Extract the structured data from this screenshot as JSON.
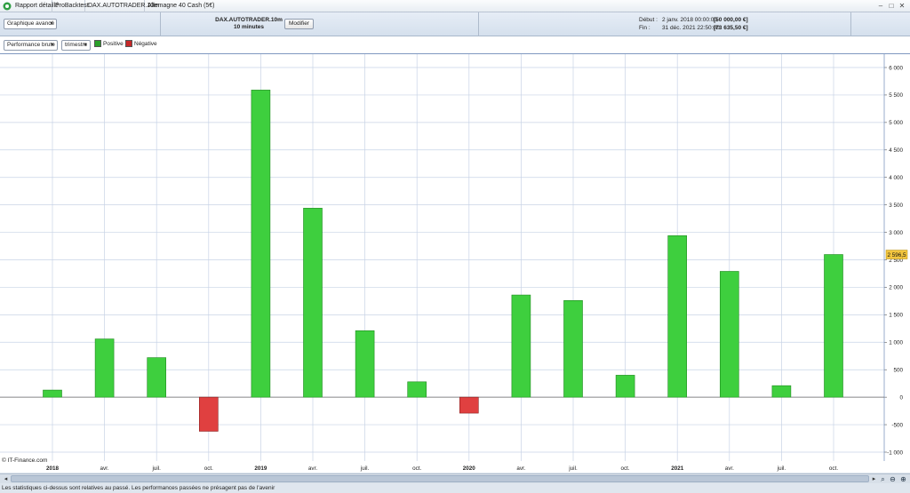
{
  "titlebar": {
    "tabs": [
      "Rapport détaillé",
      "ProBacktest",
      "DAX.AUTOTRADER.10m",
      "Allemagne 40 Cash (5€)"
    ],
    "buttons": [
      "–",
      "□",
      "✕"
    ]
  },
  "header": {
    "graph_mode": "Graphique avancé",
    "strategy_name": "DAX.AUTOTRADER.10m",
    "timeframe": "10 minutes",
    "modify_label": "Modifier",
    "start_label": "Début :",
    "start_date": "2 janv. 2018 00:00:00",
    "start_capital": "[50 000,00 €]",
    "end_label": "Fin :",
    "end_date": "31 déc. 2021 22:50:00",
    "end_capital": "[73 635,50 €]"
  },
  "toolbar": {
    "performance_type": "Performance brute",
    "period": "trimestre",
    "legend_positive": "Positive",
    "legend_negative": "Négative"
  },
  "colors": {
    "positive": "#3ecf3e",
    "positive_stroke": "#1f8a1f",
    "negative": "#e04040",
    "negative_stroke": "#8a1f1f",
    "grid": "#c8d3e6",
    "last_value_bg": "#f3c63f"
  },
  "chart_data": {
    "type": "bar",
    "categories": [
      "2018",
      "avr.",
      "juil.",
      "oct.",
      "2019",
      "avr.",
      "juil.",
      "oct.",
      "2020",
      "avr.",
      "juil.",
      "oct.",
      "2021",
      "avr.",
      "juil.",
      "oct."
    ],
    "bold_categories": [
      "2018",
      "2019",
      "2020",
      "2021"
    ],
    "values": [
      130,
      1060,
      720,
      -620,
      5590,
      3440,
      1210,
      280,
      -290,
      1860,
      1760,
      400,
      2940,
      2290,
      210,
      2596.5
    ],
    "yticks": [
      "6 000",
      "5 500",
      "5 000",
      "4 500",
      "4 000",
      "3 500",
      "3 000",
      "2 500",
      "2 000",
      "1 500",
      "1 000",
      "500",
      "0",
      "-500",
      "-1 000"
    ],
    "ylim": [
      -1000,
      6000
    ],
    "last_value_label": "2 596,5",
    "grid": true,
    "legend_position": "top-left"
  },
  "copyright": "© IT-Finance.com",
  "footer": "Les statistiques ci-dessus sont relatives au passé. Les performances passées ne présagent pas de l'avenir"
}
